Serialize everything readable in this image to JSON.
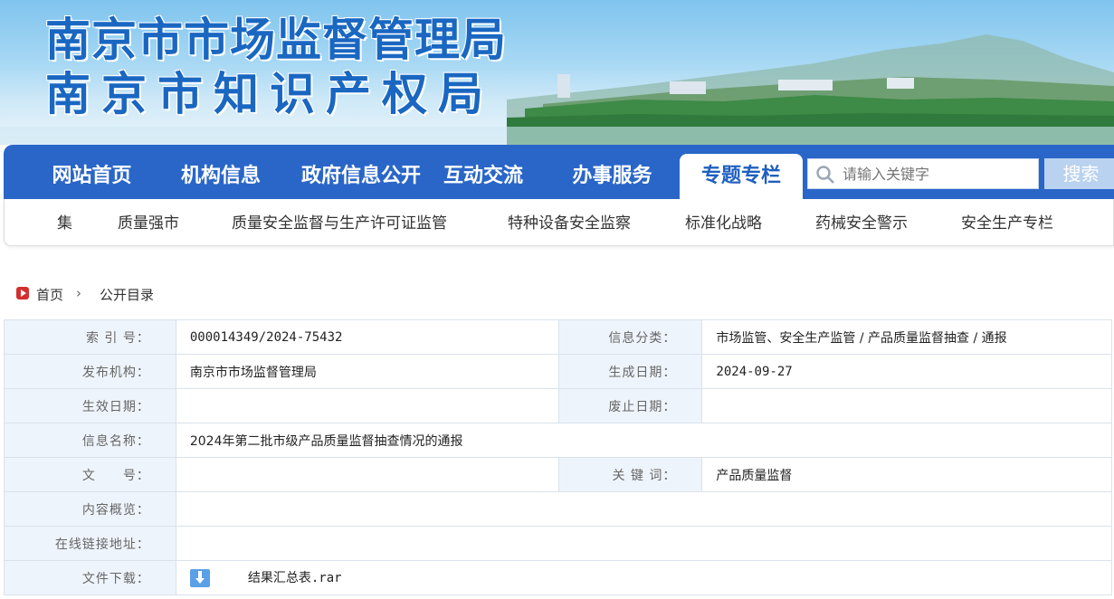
{
  "banner": {
    "title_line1": "南京市市场监督管理局",
    "title_line2": "南京市知识产权局"
  },
  "nav": {
    "items": [
      {
        "label": "网站首页"
      },
      {
        "label": "机构信息"
      },
      {
        "label": "政府信息公开"
      },
      {
        "label": "互动交流"
      },
      {
        "label": "办事服务"
      },
      {
        "label": "专题专栏"
      }
    ],
    "active": "专题专栏"
  },
  "search": {
    "placeholder": "请输入关键字",
    "button_label": "搜索",
    "icon": "search-icon"
  },
  "subnav": {
    "items": [
      {
        "label": "集"
      },
      {
        "label": "质量强市"
      },
      {
        "label": "质量安全监督与生产许可证监管"
      },
      {
        "label": "特种设备安全监察"
      },
      {
        "label": "标准化战略"
      },
      {
        "label": "药械安全警示"
      },
      {
        "label": "安全生产专栏"
      }
    ]
  },
  "breadcrumb": {
    "home": "首页",
    "separator": "›",
    "current": "公开目录"
  },
  "info": {
    "index_label": "索 引 号：",
    "index_value": "000014349/2024-75432",
    "category_label": "信息分类：",
    "category_value": "市场监管、安全生产监管 / 产品质量监督抽查 / 通报",
    "publisher_label": "发布机构：",
    "publisher_value": "南京市市场监督管理局",
    "created_label": "生成日期：",
    "created_value": "2024-09-27",
    "effective_label": "生效日期：",
    "effective_value": "",
    "abolish_label": "废止日期：",
    "abolish_value": "",
    "name_label": "信息名称：",
    "name_value": "2024年第二批市级产品质量监督抽查情况的通报",
    "docno_label": "文　　号：",
    "docno_value": "",
    "keywords_label": "关 键 词：",
    "keywords_value": "产品质量监督",
    "summary_label": "内容概览：",
    "summary_value": "",
    "link_label": "在线链接地址：",
    "link_value": "",
    "download_label": "文件下载：",
    "download_file": "结果汇总表.rar"
  },
  "colors": {
    "nav_blue": "#2a66c8",
    "title_blue": "#1a67c2",
    "label_bg": "#eef4fb"
  }
}
